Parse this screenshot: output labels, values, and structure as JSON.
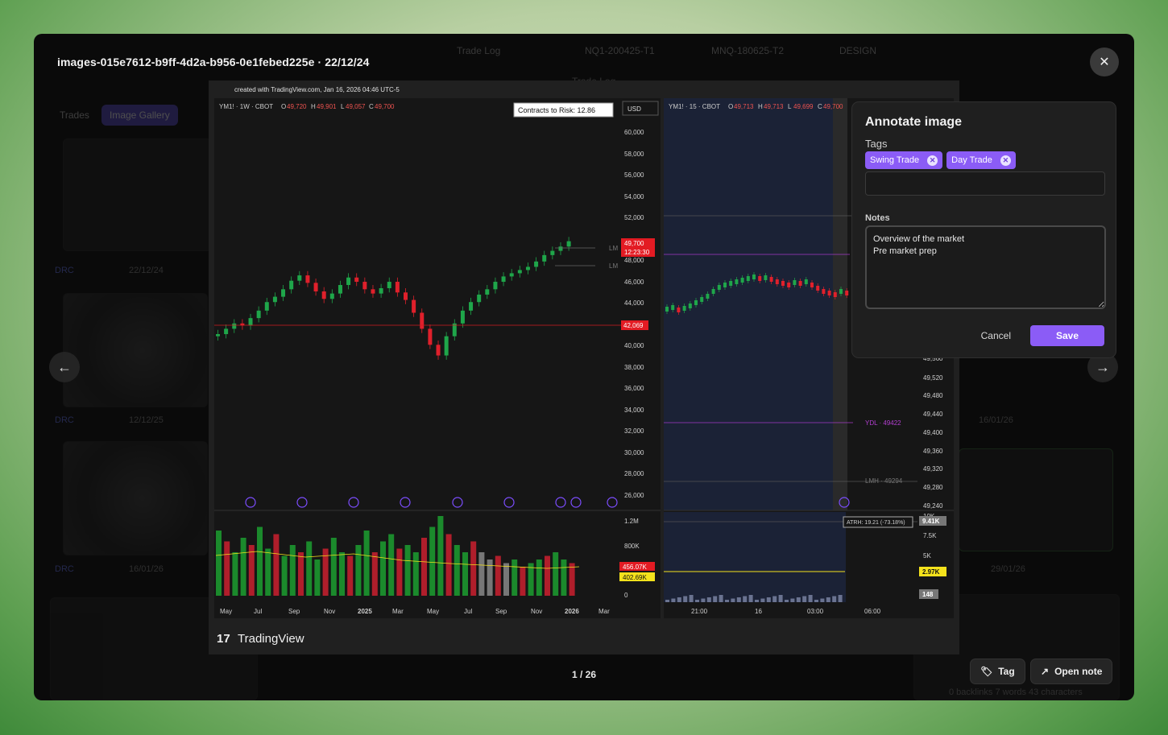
{
  "modal": {
    "title": "images-015e7612-b9ff-4d2a-b956-0e1febed225e · 22/12/24",
    "counter": "1 / 26",
    "tag_button": "Tag",
    "open_note_button": "Open note"
  },
  "background": {
    "tabs": [
      "Trade Log",
      "NQ1-200425-T1",
      "MNQ-180625-T2",
      "DESIGN"
    ],
    "subtitle": "Trade Log",
    "buttons": [
      "Trades",
      "Image Gallery"
    ],
    "labels": [
      {
        "tag": "DRC",
        "date": "22/12/24"
      },
      {
        "tag": "DRC",
        "date": "12/12/25"
      },
      {
        "tag": "DRC",
        "date": "16/01/26"
      },
      {
        "tag": "",
        "date": "16/01/26"
      },
      {
        "tag": "",
        "date": "29/01/26"
      }
    ],
    "footer": "0 backlinks   7 words  43 characters"
  },
  "chart": {
    "header": "created with TradingView.com, Jan 16, 2026 04:46 UTC-5",
    "left": {
      "symbol": "YM1! · 1W · CBOT",
      "ohlc": {
        "o": "49,720",
        "h": "49,901",
        "l": "49,057",
        "c": "49,700"
      },
      "contracts": "Contracts to Risk:  12.86",
      "currency": "USD",
      "price_ticks": [
        "60,000",
        "58,000",
        "56,000",
        "54,000",
        "52,000",
        "48,000",
        "46,000",
        "44,000",
        "40,000",
        "38,000",
        "36,000",
        "34,000",
        "32,000",
        "30,000",
        "28,000",
        "26,000"
      ],
      "last_price": "49,700",
      "countdown": "12:23:30",
      "level_price": "42,069",
      "level_tags": [
        "LM",
        "LM"
      ],
      "vol_ticks": [
        "1.2M",
        "800K",
        "0"
      ],
      "vol_red": "456.07K",
      "vol_yellow": "402.69K",
      "time_ticks": [
        "May",
        "Jul",
        "Sep",
        "Nov",
        "2025",
        "Mar",
        "May",
        "Jul",
        "Sep",
        "Nov",
        "2026",
        "Mar"
      ]
    },
    "right": {
      "symbol": "YM1! · 15 · CBOT",
      "ohlc": {
        "o": "49,713",
        "h": "49,713",
        "l": "49,699",
        "c": "49,700"
      },
      "price_ticks": [
        "49,560",
        "49,520",
        "49,480",
        "49,440",
        "49,400",
        "49,360",
        "49,320",
        "49,280",
        "49,240"
      ],
      "ydl": "YDL · 49422",
      "lmh": "LMH · 49294",
      "atr": "ATRH: 19.21 (-73.18%)",
      "vol_ticks": [
        "10K",
        "7.5K",
        "5K"
      ],
      "vol_box1": "9.41K",
      "vol_box2": "2.97K",
      "vol_box3": "148",
      "time_ticks": [
        "21:00",
        "16",
        "03:00",
        "06:00"
      ]
    },
    "brand": "TradingView",
    "colors": {
      "up": "#26a69a",
      "down": "#ef5350",
      "green_bar": "#1b8a2c",
      "red_bar": "#b01e2b"
    }
  },
  "annotate": {
    "title": "Annotate image",
    "tags_label": "Tags",
    "tags": [
      "Swing Trade",
      "Day Trade"
    ],
    "notes_label": "Notes",
    "notes_value": "Overview of the market\nPre market prep",
    "cancel": "Cancel",
    "save": "Save"
  },
  "colors": {
    "accent": "#8b5cf6",
    "window_bg": "#0a0a0a",
    "panel_bg": "#1f1f1f"
  }
}
